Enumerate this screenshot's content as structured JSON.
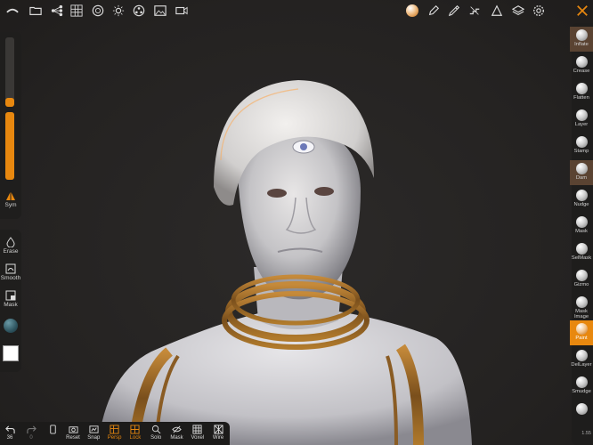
{
  "top_toolbar": {
    "icons": [
      "logo-icon",
      "folder-icon",
      "scene-tree-icon",
      "grid-icon",
      "globe-icon",
      "sun-icon",
      "material-icon",
      "image-icon",
      "video-icon",
      "matcap-icon",
      "pen-icon",
      "pipette-icon",
      "steps-icon",
      "alpha-icon",
      "layers-icon",
      "settings-icon",
      "sculpt-tools-icon"
    ]
  },
  "left_panel": {
    "radius_fraction": 0.08,
    "intensity_fraction": 1.0,
    "sym_label": "Sym",
    "erase_label": "Erase",
    "smooth_label": "Smooth",
    "mask_label": "Mask",
    "color_swatch": "#ffffff",
    "material_swatch": "#2f5560"
  },
  "right_tools": [
    {
      "label": "Inflate",
      "state": "sel"
    },
    {
      "label": "Crease",
      "state": ""
    },
    {
      "label": "Flatten",
      "state": ""
    },
    {
      "label": "Layer",
      "state": ""
    },
    {
      "label": "Stamp",
      "state": ""
    },
    {
      "label": "Dam",
      "state": "sel"
    },
    {
      "label": "Nudge",
      "state": ""
    },
    {
      "label": "Mask",
      "state": ""
    },
    {
      "label": "SelMask",
      "state": ""
    },
    {
      "label": "Gizmo",
      "state": ""
    },
    {
      "label": "Mask Image",
      "state": ""
    },
    {
      "label": "Paint",
      "state": "active"
    },
    {
      "label": "DelLayer",
      "state": ""
    },
    {
      "label": "Smudge",
      "state": ""
    },
    {
      "label": "",
      "state": ""
    }
  ],
  "right_footer": "1.55",
  "bottom_toolbar": {
    "undo_count": "36",
    "redo_count": "0",
    "items": [
      {
        "label": "Reset",
        "orange": false
      },
      {
        "label": "Snap",
        "orange": false
      },
      {
        "label": "Persp",
        "orange": true
      },
      {
        "label": "Lock",
        "orange": true
      },
      {
        "label": "Solo",
        "orange": false
      },
      {
        "label": "Mask",
        "orange": false
      },
      {
        "label": "Voxel",
        "orange": false
      },
      {
        "label": "Wire",
        "orange": false
      }
    ]
  },
  "colors": {
    "accent": "#e8880f",
    "panel": "#1f1e1d",
    "background": "#272524"
  }
}
